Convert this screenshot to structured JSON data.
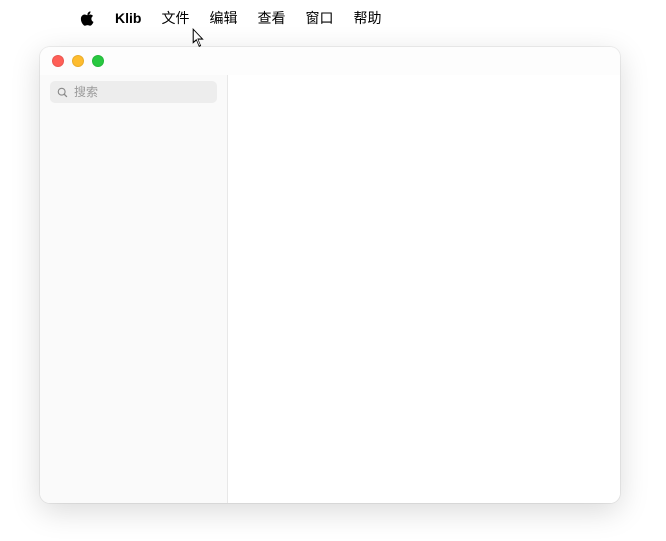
{
  "menubar": {
    "app_name": "Klib",
    "items": [
      "文件",
      "编辑",
      "查看",
      "窗口",
      "帮助"
    ]
  },
  "sidebar": {
    "search_placeholder": "搜索"
  }
}
